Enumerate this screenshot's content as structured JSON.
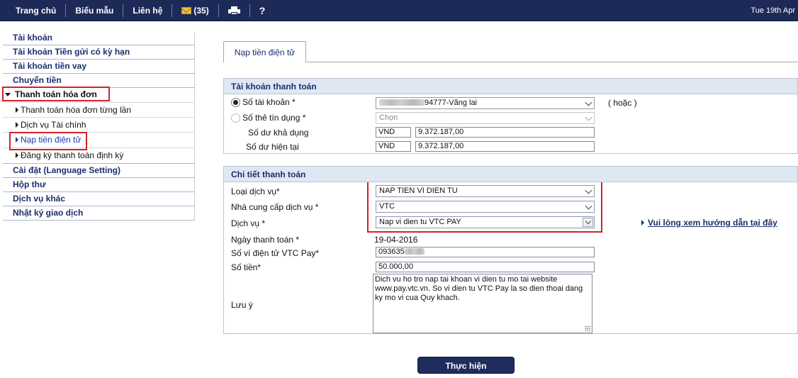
{
  "topbar": {
    "nav": [
      "Trang chủ",
      "Biểu mẫu",
      "Liên hệ"
    ],
    "mail_count": "(35)",
    "help": "?",
    "date": "Tue 19th Apr",
    "icons": [
      "mail-icon",
      "printer-icon",
      "help-icon"
    ]
  },
  "sidebar": {
    "items": [
      "Tài khoản",
      "Tài khoản Tiền gửi có kỳ hạn",
      "Tài khoản tiền vay",
      "Chuyển tiền",
      "Thanh toán hóa đơn",
      "Cài đặt (Language Setting)",
      "Hộp thư",
      "Dịch vụ khác",
      "Nhật ký giao dịch"
    ],
    "subitems": [
      "Thanh toán hóa đơn từng lần",
      "Dịch vụ Tài chính",
      "Nạp tiền điện tử",
      "Đăng ký thanh toán định kỳ"
    ]
  },
  "tab": {
    "label": "Nạp tiền điện tử"
  },
  "account_panel": {
    "title": "Tài khoản thanh toán",
    "account_label": "Số tài khoản *",
    "account_value": "94777-Vãng lai",
    "or_label": "( hoặc )",
    "card_label": "Số thẻ tín dụng *",
    "card_placeholder": "Chọn",
    "available_label": "Số dư khả dụng",
    "current_label": "Số dư hiện tại",
    "currency": "VND",
    "available_value": "9.372.187,00",
    "current_value": "9.372.187,00"
  },
  "detail_panel": {
    "title": "Chi tiết thanh toán",
    "service_type_label": "Loại dịch vụ*",
    "service_type_value": "NAP TIEN VI DIEN TU",
    "provider_label": "Nhà cung cấp dịch vụ *",
    "provider_value": "VTC",
    "service_label": "Dịch vụ *",
    "service_value": "Nap vi dien tu VTC PAY",
    "guide_link": "Vui lòng xem hướng dẫn tại đây",
    "date_label": "Ngày thanh toán *",
    "date_value": "19-04-2016",
    "wallet_label": "Số ví điện tử VTC Pay*",
    "wallet_value": "093635",
    "amount_label": "Số tiền*",
    "amount_value": "50.000,00",
    "note_label": "Lưu ý",
    "note_text": "Dich vu ho tro nap tai khoan vi dien tu mo tai website www.pay.vtc.vn. So vi dien tu VTC Pay la so dien thoai dang ky mo vi cua Quy khach."
  },
  "submit_label": "Thực hiện",
  "colors": {
    "topbar": "#1d2a57",
    "panel_head": "#dfe8f2",
    "highlight": "#d62027",
    "link": "#1a2e6e"
  }
}
